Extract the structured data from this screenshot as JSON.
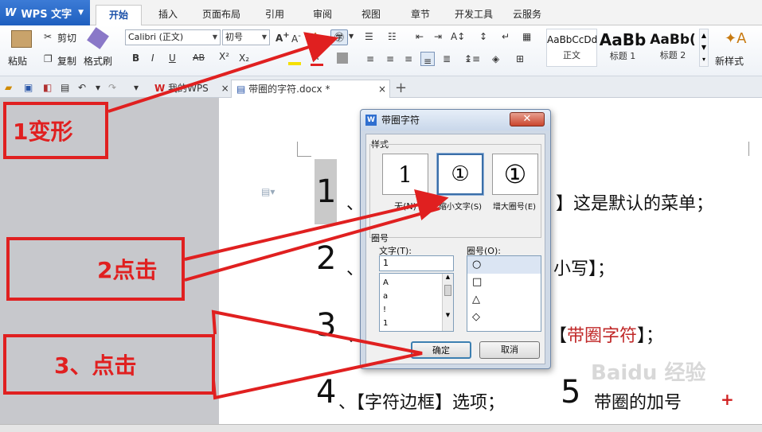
{
  "app": {
    "logo": "W",
    "name": "WPS 文字"
  },
  "tabs": [
    "开始",
    "插入",
    "页面布局",
    "引用",
    "审阅",
    "视图",
    "章节",
    "开发工具",
    "云服务"
  ],
  "ribbon": {
    "paste": "粘贴",
    "cut": "剪切",
    "copy": "复制",
    "format_painter": "格式刷",
    "font_name": "Calibri (正文)",
    "font_size": "初号",
    "style_samples": [
      "AaBbCcDd",
      "AaBb",
      "AaBb("
    ],
    "style_names": [
      "正文",
      "标题 1",
      "标题 2"
    ],
    "new_style": "新样式"
  },
  "doc_tabs": {
    "home": "我的WPS",
    "file": "带圈的字符.docx *",
    "add": "+"
  },
  "document": {
    "lines": [
      {
        "num": "1",
        "text": "、",
        "tail": "】这是默认的菜单；"
      },
      {
        "num": "2",
        "text": "、",
        "tail": "小写】；"
      },
      {
        "num": "3",
        "text": "、",
        "tail_pre": "【",
        "tail_red": "带圈字符",
        "tail_post": "】；"
      },
      {
        "num": "4",
        "text": "、【字符边框】选项；",
        "num2": "5",
        "tail": "带圈的加号",
        "plus": "+"
      }
    ],
    "fragment": "页"
  },
  "dialog": {
    "title": "带圈字符",
    "style_label": "样式",
    "options": [
      {
        "glyph": "1",
        "label": "无(N)"
      },
      {
        "glyph": "①",
        "label": "缩小文字(S)"
      },
      {
        "glyph": "①",
        "label": "增大圈号(E)"
      }
    ],
    "circle_label": "圈号",
    "text_label": "文字(T):",
    "text_value": "1",
    "text_list": [
      "A",
      "a",
      "!",
      "1"
    ],
    "shape_label": "圈号(O):",
    "shapes": [
      "○",
      "□",
      "△",
      "◇"
    ],
    "ok": "确定",
    "cancel": "取消"
  },
  "annotations": {
    "step1": "1变形",
    "step2": "2点击",
    "step3": "3、点击",
    "color": "#e02020"
  },
  "watermark": "Baidu 经验"
}
